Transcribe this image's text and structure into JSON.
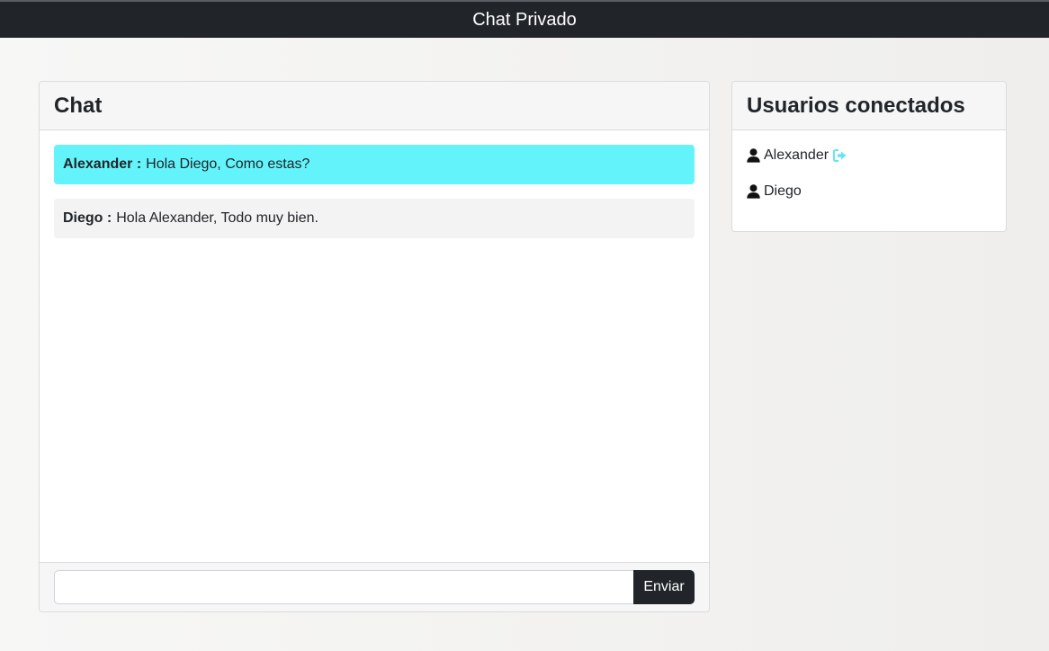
{
  "navbar": {
    "title": "Chat Privado"
  },
  "chat": {
    "title": "Chat",
    "messages": [
      {
        "sender": "Alexander :",
        "text": "Hola Diego, Como estas?",
        "mine": true
      },
      {
        "sender": "Diego :",
        "text": "Hola Alexander, Todo muy bien.",
        "mine": false
      }
    ],
    "input": {
      "value": "",
      "placeholder": ""
    },
    "send_label": "Enviar"
  },
  "users": {
    "title": "Usuarios conectados",
    "list": [
      {
        "name": "Alexander",
        "icon": "user-icon",
        "action_icon": "sign-out-icon"
      },
      {
        "name": "Diego",
        "icon": "user-icon"
      }
    ]
  },
  "colors": {
    "navbar": "#212529",
    "own_message": "#63f4fb",
    "other_message": "#f3f3f3",
    "sign_out_icon": "#63e6f2",
    "button": "#212529"
  }
}
